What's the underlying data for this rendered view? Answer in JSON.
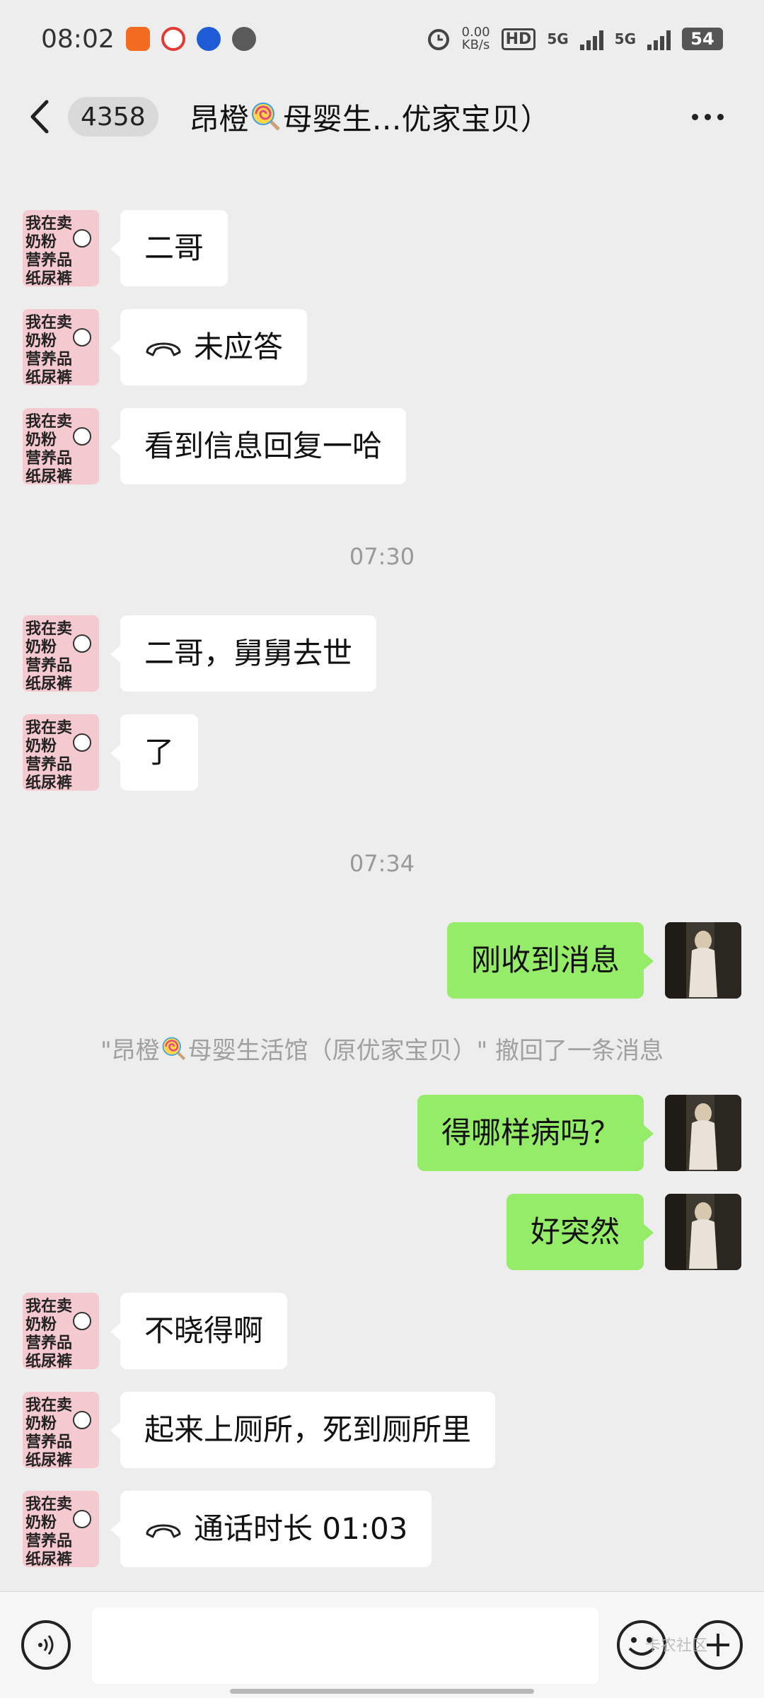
{
  "status_bar": {
    "time": "08:02",
    "net_speed_value": "0.00",
    "net_speed_unit": "KB/s",
    "hd_label": "HD",
    "sim1": "5G",
    "sim2": "5G",
    "battery": "54"
  },
  "header": {
    "unread_count": "4358",
    "title_prefix": "昂橙",
    "title_suffix": "母婴生…优家宝贝）"
  },
  "avatar_contact": {
    "lines": [
      "我在卖",
      "奶粉",
      "营养品",
      "纸尿裤"
    ]
  },
  "messages": [
    {
      "text": "二哥"
    },
    {
      "text": "未应答"
    },
    {
      "text": "看到信息回复一哈"
    },
    {
      "text": "07:30"
    },
    {
      "text": "二哥，舅舅去世"
    },
    {
      "text": "了"
    },
    {
      "text": "07:34"
    },
    {
      "text": "刚收到消息"
    },
    {
      "text_prefix": "\"昂橙",
      "text_suffix": "母婴生活馆（原优家宝贝）\" 撤回了一条消息"
    },
    {
      "text": "得哪样病吗？"
    },
    {
      "text": "好突然"
    },
    {
      "text": "不晓得啊"
    },
    {
      "text": "起来上厕所，死到厕所里"
    },
    {
      "text": "通话时长 01:03"
    }
  ],
  "input_bar": {
    "placeholder": ""
  },
  "watermark": "卡农社区",
  "colors": {
    "background": "#ededed",
    "outgoing_bubble": "#95ec69",
    "incoming_bubble": "#ffffff",
    "avatar_pink": "#f4c9cf"
  },
  "icons": [
    "back-icon",
    "more-icon",
    "voice-icon",
    "emoji-icon",
    "plus-icon",
    "phone-icon",
    "lollipop-icon",
    "alarm-icon"
  ]
}
